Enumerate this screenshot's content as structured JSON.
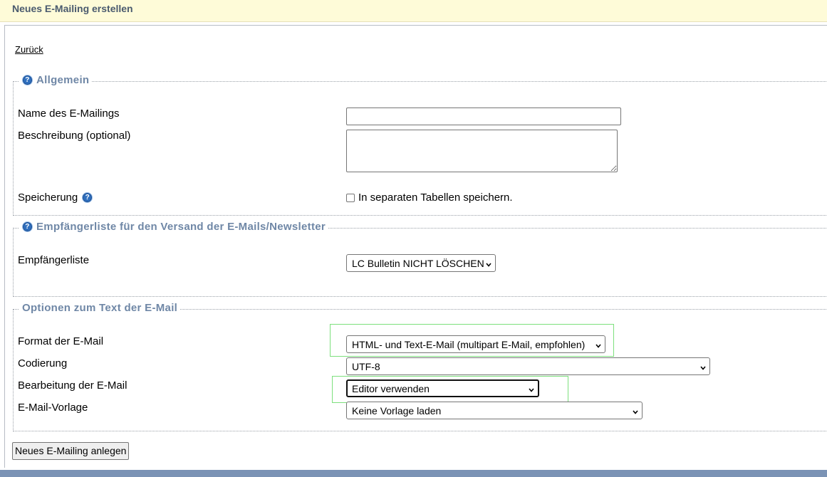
{
  "header": {
    "title": "Neues E-Mailing erstellen"
  },
  "back_link": "Zurück",
  "sections": {
    "general": {
      "legend": "Allgemein",
      "name_label": "Name des E-Mailings",
      "name_value": "",
      "description_label": "Beschreibung (optional)",
      "description_value": "",
      "storage_label": "Speicherung",
      "storage_checkbox_label": "In separaten Tabellen speichern."
    },
    "recipients": {
      "legend": "Empfängerliste für den Versand der E-Mails/Newsletter",
      "list_label": "Empfängerliste",
      "list_value": "LC Bulletin NICHT LÖSCHEN"
    },
    "text_options": {
      "legend": "Optionen zum Text der E-Mail",
      "format_label": "Format der E-Mail",
      "format_value": "HTML- und Text-E-Mail (multipart E-Mail, empfohlen)",
      "encoding_label": "Codierung",
      "encoding_value": "UTF-8",
      "editing_label": "Bearbeitung der E-Mail",
      "editing_value": "Editor verwenden",
      "template_label": "E-Mail-Vorlage",
      "template_value": "Keine Vorlage laden"
    }
  },
  "submit_label": "Neues E-Mailing anlegen",
  "icons": {
    "help": "help-icon",
    "dropdown": "chevron-down-icon"
  },
  "colors": {
    "header_bg": "#fefbd8",
    "legend_text": "#6f87a6",
    "highlight_box": "#7de07d",
    "footer_bar": "#7b93b5"
  }
}
